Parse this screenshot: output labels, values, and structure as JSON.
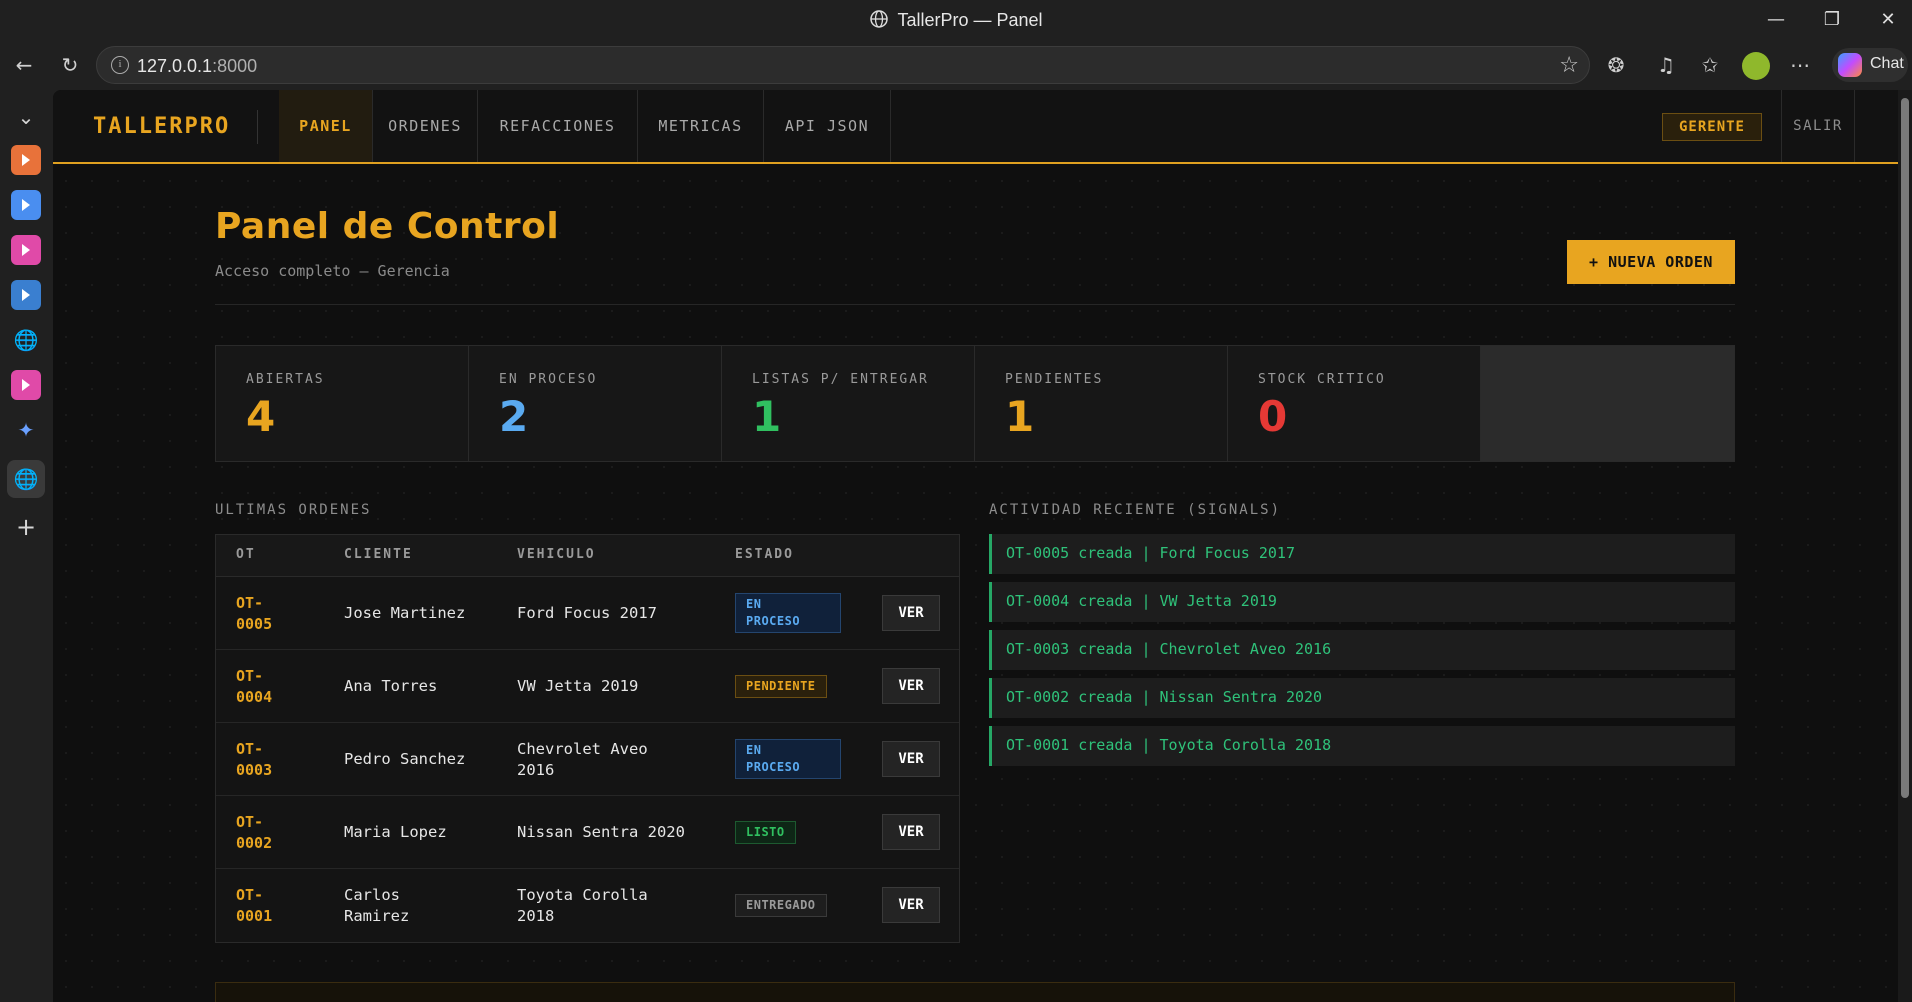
{
  "browser": {
    "window_title": "TallerPro — Panel",
    "url_host": "127.0.0.1",
    "url_port": ":8000",
    "chat_label": "Chat",
    "accent_colors": [
      "#e8723a",
      "#4a8ef0",
      "#e04aa8",
      "#3a7fd0",
      "#e04aa8"
    ]
  },
  "nav": {
    "brand": "TALLERPRO",
    "tabs": [
      {
        "label": "PANEL",
        "active": true
      },
      {
        "label": "ORDENES",
        "active": false
      },
      {
        "label": "REFACCIONES",
        "active": false
      },
      {
        "label": "METRICAS",
        "active": false
      },
      {
        "label": "API JSON",
        "active": false
      }
    ],
    "role": "GERENTE",
    "logout": "SALIR"
  },
  "header": {
    "title": "Panel de Control",
    "subtitle": "Acceso completo — Gerencia",
    "new_order_button": "+ NUEVA ORDEN"
  },
  "stats": [
    {
      "label": "ABIERTAS",
      "value": "4",
      "color": "#e8a520"
    },
    {
      "label": "EN PROCESO",
      "value": "2",
      "color": "#5aaaf0"
    },
    {
      "label": "LISTAS P/ ENTREGAR",
      "value": "1",
      "color": "#30c060"
    },
    {
      "label": "PENDIENTES",
      "value": "1",
      "color": "#e8a520"
    },
    {
      "label": "STOCK CRITICO",
      "value": "0",
      "color": "#e53935"
    }
  ],
  "orders": {
    "section_label": "ULTIMAS ORDENES",
    "columns": [
      "OT",
      "CLIENTE",
      "VEHICULO",
      "ESTADO"
    ],
    "action_label": "VER",
    "rows": [
      {
        "ot_line1": "OT-",
        "ot_line2": "0005",
        "client": "Jose Martinez",
        "vehicle": "Ford Focus 2017",
        "status_line1": "EN",
        "status_line2": "PROCESO",
        "status": "EN PROCESO"
      },
      {
        "ot_line1": "OT-",
        "ot_line2": "0004",
        "client": "Ana Torres",
        "vehicle": "VW Jetta 2019",
        "status": "PENDIENTE"
      },
      {
        "ot_line1": "OT-",
        "ot_line2": "0003",
        "client": "Pedro Sanchez",
        "vehicle_line1": "Chevrolet Aveo",
        "vehicle_line2": "2016",
        "vehicle": "Chevrolet Aveo 2016",
        "status_line1": "EN",
        "status_line2": "PROCESO",
        "status": "EN PROCESO"
      },
      {
        "ot_line1": "OT-",
        "ot_line2": "0002",
        "client": "Maria Lopez",
        "vehicle": "Nissan Sentra 2020",
        "status": "LISTO"
      },
      {
        "ot_line1": "OT-",
        "ot_line2": "0001",
        "client_line1": "Carlos",
        "client_line2": "Ramirez",
        "client": "Carlos Ramirez",
        "vehicle_line1": "Toyota Corolla",
        "vehicle_line2": "2018",
        "vehicle": "Toyota Corolla 2018",
        "status": "ENTREGADO"
      }
    ]
  },
  "activity": {
    "section_label": "ACTIVIDAD RECIENTE (SIGNALS)",
    "items": [
      "OT-0005 creada | Ford Focus 2017",
      "OT-0004 creada | VW Jetta 2019",
      "OT-0003 creada | Chevrolet Aveo 2016",
      "OT-0002 creada | Nissan Sentra 2020",
      "OT-0001 creada | Toyota Corolla 2018"
    ]
  }
}
